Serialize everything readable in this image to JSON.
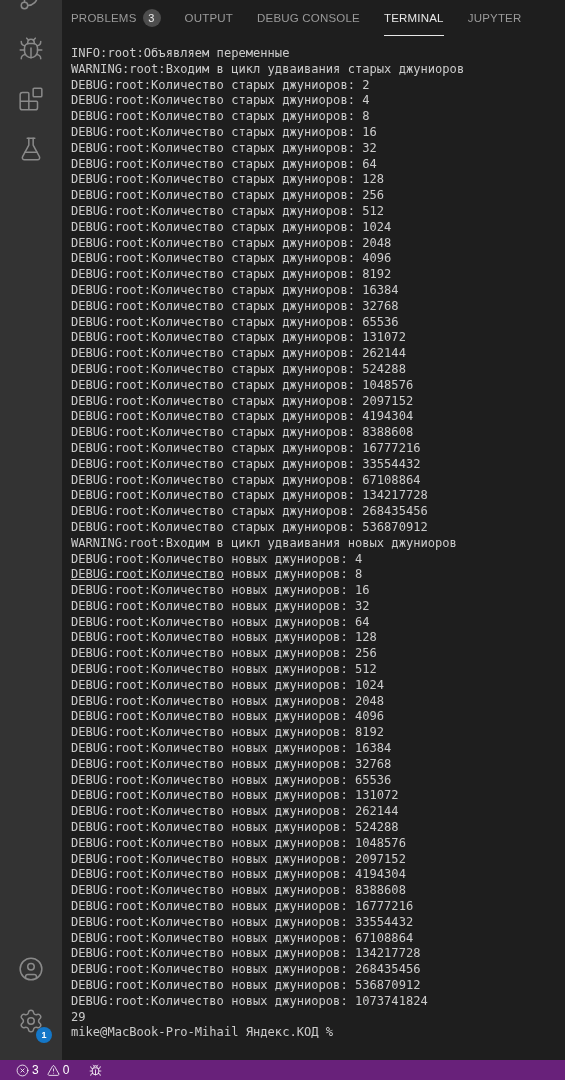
{
  "activity_bar": {
    "top": [
      {
        "kind": "source-control"
      },
      {
        "kind": "run-debug"
      },
      {
        "kind": "extensions"
      },
      {
        "kind": "testing"
      }
    ],
    "bottom": [
      {
        "kind": "account"
      },
      {
        "kind": "settings",
        "badge": "1"
      }
    ]
  },
  "tabs": [
    {
      "label": "PROBLEMS",
      "badge": "3",
      "selected": false
    },
    {
      "label": "OUTPUT",
      "selected": false
    },
    {
      "label": "DEBUG CONSOLE",
      "selected": false
    },
    {
      "label": "TERMINAL",
      "selected": true
    },
    {
      "label": "JUPYTER",
      "selected": false
    }
  ],
  "terminal": {
    "lines": [
      {
        "text": "INFO:root:Объявляем переменные"
      },
      {
        "text": "WARNING:root:Входим в цикл удваивания старых джуниоров"
      },
      {
        "text": "DEBUG:root:Количество старых джуниоров: 2"
      },
      {
        "text": "DEBUG:root:Количество старых джуниоров: 4"
      },
      {
        "text": "DEBUG:root:Количество старых джуниоров: 8"
      },
      {
        "text": "DEBUG:root:Количество старых джуниоров: 16"
      },
      {
        "text": "DEBUG:root:Количество старых джуниоров: 32"
      },
      {
        "text": "DEBUG:root:Количество старых джуниоров: 64"
      },
      {
        "text": "DEBUG:root:Количество старых джуниоров: 128"
      },
      {
        "text": "DEBUG:root:Количество старых джуниоров: 256"
      },
      {
        "text": "DEBUG:root:Количество старых джуниоров: 512"
      },
      {
        "text": "DEBUG:root:Количество старых джуниоров: 1024"
      },
      {
        "text": "DEBUG:root:Количество старых джуниоров: 2048"
      },
      {
        "text": "DEBUG:root:Количество старых джуниоров: 4096"
      },
      {
        "text": "DEBUG:root:Количество старых джуниоров: 8192"
      },
      {
        "text": "DEBUG:root:Количество старых джуниоров: 16384"
      },
      {
        "text": "DEBUG:root:Количество старых джуниоров: 32768"
      },
      {
        "text": "DEBUG:root:Количество старых джуниоров: 65536"
      },
      {
        "text": "DEBUG:root:Количество старых джуниоров: 131072"
      },
      {
        "text": "DEBUG:root:Количество старых джуниоров: 262144"
      },
      {
        "text": "DEBUG:root:Количество старых джуниоров: 524288"
      },
      {
        "text": "DEBUG:root:Количество старых джуниоров: 1048576"
      },
      {
        "text": "DEBUG:root:Количество старых джуниоров: 2097152"
      },
      {
        "text": "DEBUG:root:Количество старых джуниоров: 4194304"
      },
      {
        "text": "DEBUG:root:Количество старых джуниоров: 8388608"
      },
      {
        "text": "DEBUG:root:Количество старых джуниоров: 16777216"
      },
      {
        "text": "DEBUG:root:Количество старых джуниоров: 33554432"
      },
      {
        "text": "DEBUG:root:Количество старых джуниоров: 67108864"
      },
      {
        "text": "DEBUG:root:Количество старых джуниоров: 134217728"
      },
      {
        "text": "DEBUG:root:Количество старых джуниоров: 268435456"
      },
      {
        "text": "DEBUG:root:Количество старых джуниоров: 536870912"
      },
      {
        "text": "WARNING:root:Входим в цикл удваивания новых джуниоров"
      },
      {
        "text": "DEBUG:root:Количество новых джуниоров: 4"
      },
      {
        "link": "DEBUG:root:Количество",
        "text": " новых джуниоров: 8"
      },
      {
        "text": "DEBUG:root:Количество новых джуниоров: 16"
      },
      {
        "text": "DEBUG:root:Количество новых джуниоров: 32"
      },
      {
        "text": "DEBUG:root:Количество новых джуниоров: 64"
      },
      {
        "text": "DEBUG:root:Количество новых джуниоров: 128"
      },
      {
        "text": "DEBUG:root:Количество новых джуниоров: 256"
      },
      {
        "text": "DEBUG:root:Количество новых джуниоров: 512"
      },
      {
        "text": "DEBUG:root:Количество новых джуниоров: 1024"
      },
      {
        "text": "DEBUG:root:Количество новых джуниоров: 2048"
      },
      {
        "text": "DEBUG:root:Количество новых джуниоров: 4096"
      },
      {
        "text": "DEBUG:root:Количество новых джуниоров: 8192"
      },
      {
        "text": "DEBUG:root:Количество новых джуниоров: 16384"
      },
      {
        "text": "DEBUG:root:Количество новых джуниоров: 32768"
      },
      {
        "text": "DEBUG:root:Количество новых джуниоров: 65536"
      },
      {
        "text": "DEBUG:root:Количество новых джуниоров: 131072"
      },
      {
        "text": "DEBUG:root:Количество новых джуниоров: 262144"
      },
      {
        "text": "DEBUG:root:Количество новых джуниоров: 524288"
      },
      {
        "text": "DEBUG:root:Количество новых джуниоров: 1048576"
      },
      {
        "text": "DEBUG:root:Количество новых джуниоров: 2097152"
      },
      {
        "text": "DEBUG:root:Количество новых джуниоров: 4194304"
      },
      {
        "text": "DEBUG:root:Количество новых джуниоров: 8388608"
      },
      {
        "text": "DEBUG:root:Количество новых джуниоров: 16777216"
      },
      {
        "text": "DEBUG:root:Количество новых джуниоров: 33554432"
      },
      {
        "text": "DEBUG:root:Количество новых джуниоров: 67108864"
      },
      {
        "text": "DEBUG:root:Количество новых джуниоров: 134217728"
      },
      {
        "text": "DEBUG:root:Количество новых джуниоров: 268435456"
      },
      {
        "text": "DEBUG:root:Количество новых джуниоров: 536870912"
      },
      {
        "text": "DEBUG:root:Количество новых джуниоров: 1073741824"
      },
      {
        "text": "29"
      },
      {
        "text": "mike@MacBook-Pro-Mihail Яндекс.КОД %"
      }
    ]
  },
  "status_bar": {
    "errors": "3",
    "warnings": "0"
  }
}
